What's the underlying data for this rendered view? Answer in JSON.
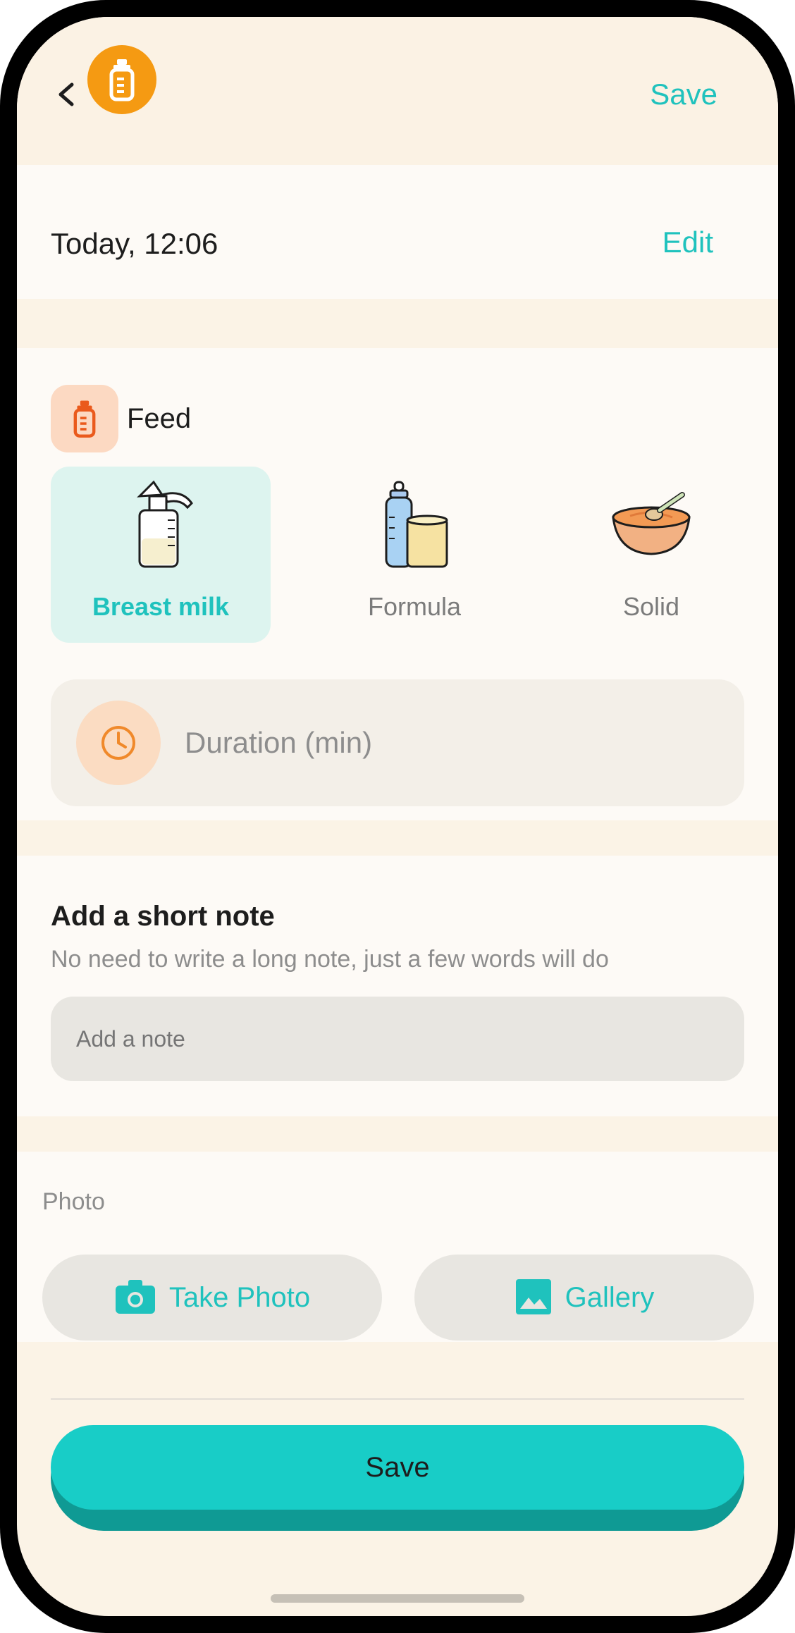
{
  "header": {
    "back_icon": "chevron-left-icon",
    "app_icon": "baby-bottle-icon",
    "save_label": "Save"
  },
  "entry": {
    "datetime": "Today, 12:06",
    "edit_label": "Edit"
  },
  "feed": {
    "title": "Feed",
    "icon": "baby-bottle-icon",
    "types": [
      {
        "label": "Breast milk",
        "icon": "breast-pump-icon",
        "selected": true
      },
      {
        "label": "Formula",
        "icon": "formula-icon",
        "selected": false
      },
      {
        "label": "Solid",
        "icon": "bowl-icon",
        "selected": false
      }
    ],
    "duration_placeholder": "Duration (min)",
    "duration_icon": "clock-icon"
  },
  "note": {
    "title": "Add a short note",
    "subtitle": "No need to write a long note, just a few words will do",
    "placeholder": "Add a note"
  },
  "photo": {
    "label": "Photo",
    "take_photo_label": "Take Photo",
    "gallery_label": "Gallery"
  },
  "footer": {
    "save_label": "Save"
  },
  "colors": {
    "accent": "#1fc2bd",
    "orange": "#f59a12",
    "background": "#fbf3e6"
  }
}
